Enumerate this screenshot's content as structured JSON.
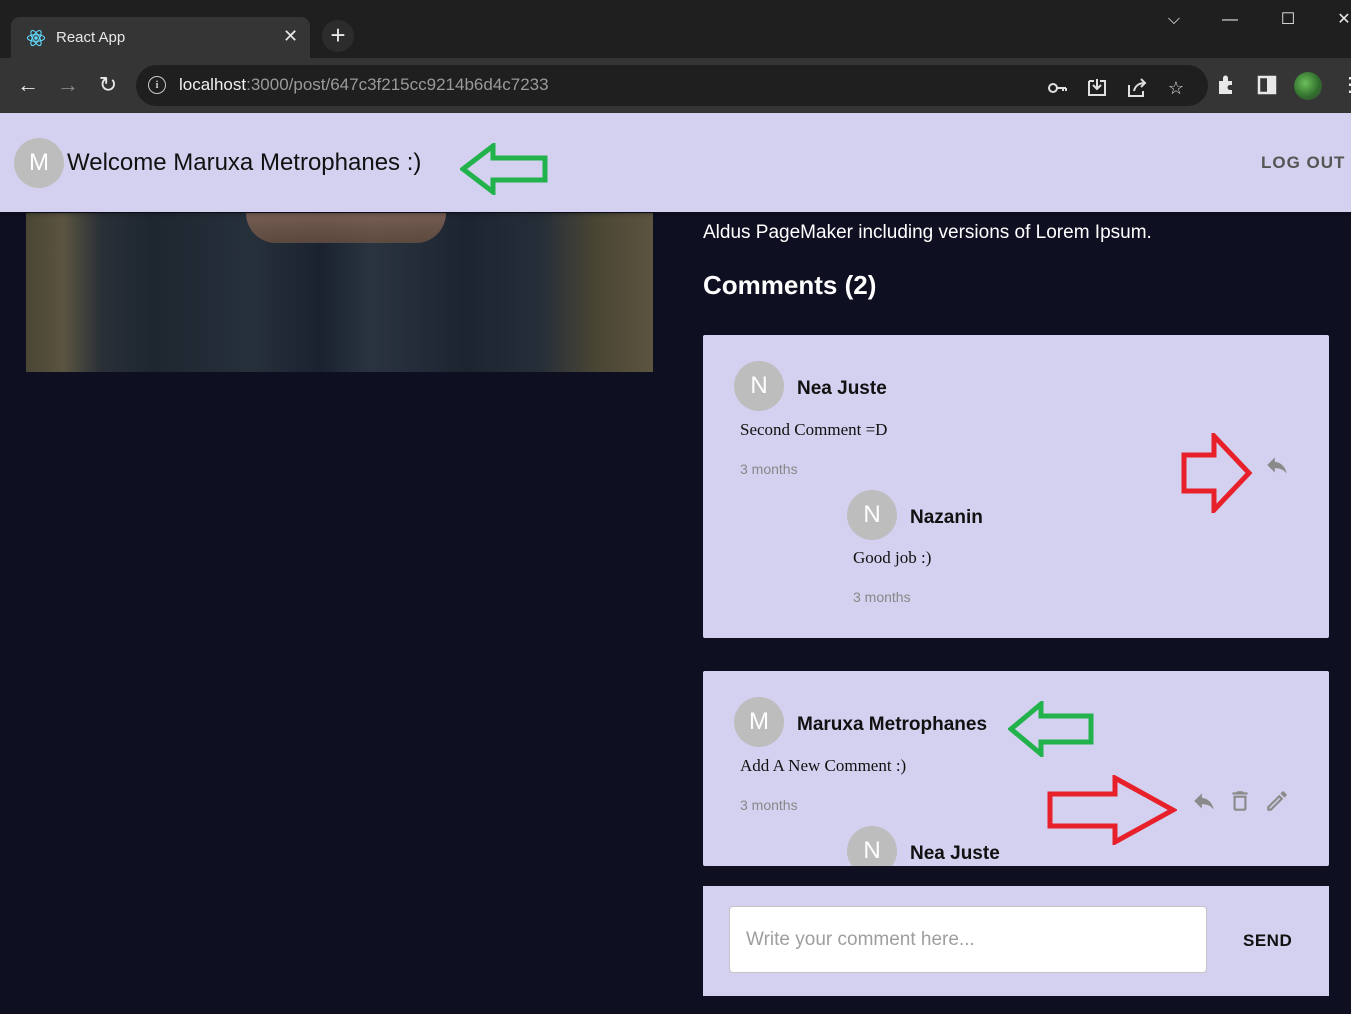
{
  "browser": {
    "tab_title": "React App",
    "url_host": "localhost",
    "url_path": ":3000/post/647c3f215cc9214b6d4c7233",
    "icons": [
      "react-favicon",
      "close-icon",
      "plus-icon",
      "back-icon",
      "forward-icon",
      "reload-icon",
      "info-icon",
      "key-icon",
      "install-icon",
      "share-icon",
      "star-icon",
      "extensions-icon",
      "sidepanel-icon",
      "profile-avatar",
      "menu-icon",
      "minimize-icon",
      "maximize-icon",
      "close-window-icon",
      "tab-search-icon"
    ]
  },
  "header": {
    "avatar_letter": "M",
    "welcome": "Welcome Maruxa Metrophanes :)",
    "logout": "LOG OUT"
  },
  "post": {
    "text_fragment": "Aldus PageMaker including versions of Lorem Ipsum."
  },
  "comments": {
    "title": "Comments (2)",
    "items": [
      {
        "avatar": "N",
        "author": "Nea Juste",
        "body": "Second Comment =D",
        "time": "3 months",
        "actions": [
          "reply-icon"
        ],
        "replies": [
          {
            "avatar": "N",
            "author": "Nazanin",
            "body": "Good job :)",
            "time": "3 months"
          }
        ]
      },
      {
        "avatar": "M",
        "author": "Maruxa Metrophanes",
        "body": "Add A New Comment :)",
        "time": "3 months",
        "actions": [
          "reply-icon",
          "delete-icon",
          "edit-icon"
        ],
        "replies": [
          {
            "avatar": "N",
            "author": "Nea Juste"
          }
        ]
      }
    ]
  },
  "composer": {
    "placeholder": "Write your comment here...",
    "send": "SEND"
  },
  "colors": {
    "header_bg": "#d3d1ef",
    "page_bg": "#0f0f22",
    "annotation_green": "#22b24c",
    "annotation_red": "#e8202a"
  }
}
